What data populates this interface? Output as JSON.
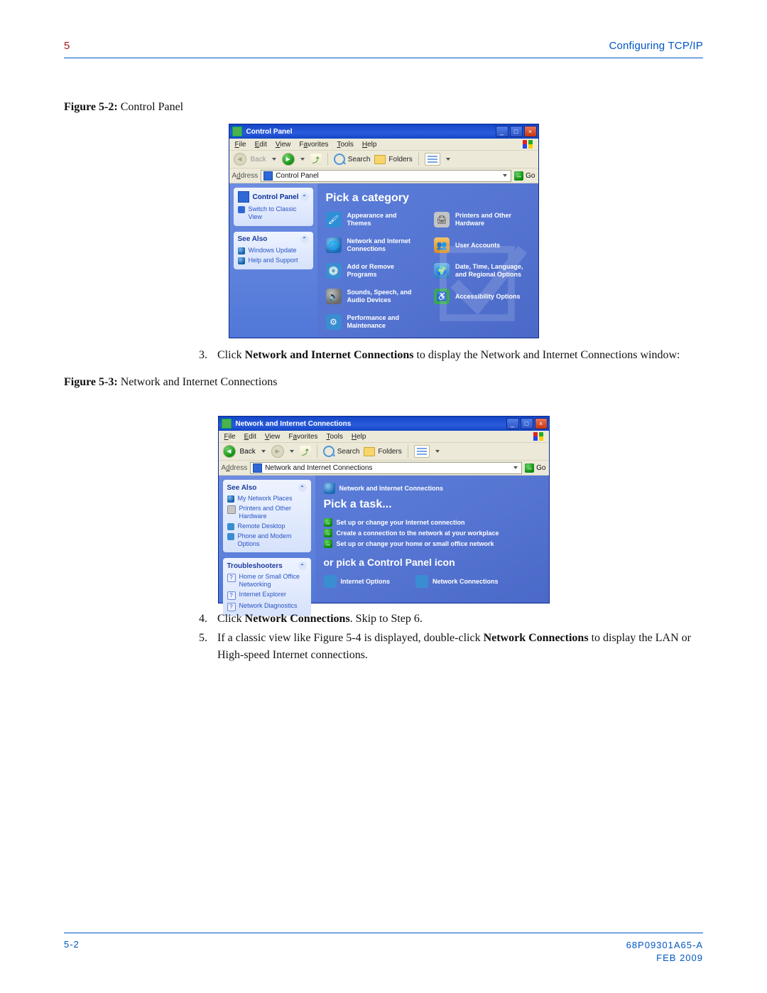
{
  "header": {
    "chapter": "5",
    "title": "Configuring TCP/IP"
  },
  "figure1": {
    "prefix": "Figure 5-2:",
    "caption": "Control Panel"
  },
  "figure2": {
    "prefix": "Figure 5-3:",
    "caption": "Network and Internet Connections"
  },
  "steps": {
    "s3": {
      "num": "3.",
      "pre": "Click ",
      "bold": "Network and Internet Connections",
      "post": " to display the Network and Internet Connections window:"
    },
    "s4": {
      "num": "4.",
      "pre": "Click ",
      "bold": "Network Connections",
      "post": ". Skip to Step 6."
    },
    "s5": {
      "num": "5.",
      "pre": "If a classic view like Figure 5-4 is displayed, double-click ",
      "bold": "Network Connections",
      "post": " to display the LAN or High-speed Internet connections."
    }
  },
  "footer": {
    "left": "5-2",
    "doc": "68P09301A65-A",
    "date": "FEB 2009"
  },
  "win1": {
    "title": "Control Panel",
    "menus": [
      "File",
      "Edit",
      "View",
      "Favorites",
      "Tools",
      "Help"
    ],
    "back": "Back",
    "search": "Search",
    "folders": "Folders",
    "addressLabel": "Address",
    "addressValue": "Control Panel",
    "go": "Go",
    "side": {
      "cp": {
        "title": "Control Panel",
        "switch": "Switch to Classic View"
      },
      "seeAlso": {
        "title": "See Also",
        "items": [
          "Windows Update",
          "Help and Support"
        ]
      }
    },
    "content": {
      "heading": "Pick a category",
      "cats": [
        "Appearance and Themes",
        "Printers and Other Hardware",
        "Network and Internet Connections",
        "User Accounts",
        "Add or Remove Programs",
        "Date, Time, Language, and Regional Options",
        "Sounds, Speech, and Audio Devices",
        "Accessibility Options",
        "Performance and Maintenance"
      ]
    }
  },
  "win2": {
    "title": "Network and Internet Connections",
    "menus": [
      "File",
      "Edit",
      "View",
      "Favorites",
      "Tools",
      "Help"
    ],
    "back": "Back",
    "search": "Search",
    "folders": "Folders",
    "addressLabel": "Address",
    "addressValue": "Network and Internet Connections",
    "go": "Go",
    "side": {
      "seeAlso": {
        "title": "See Also",
        "items": [
          "My Network Places",
          "Printers and Other Hardware",
          "Remote Desktop",
          "Phone and Modem Options"
        ]
      },
      "trouble": {
        "title": "Troubleshooters",
        "items": [
          "Home or Small Office Networking",
          "Internet Explorer",
          "Network Diagnostics"
        ]
      }
    },
    "content": {
      "crumb": "Network and Internet Connections",
      "heading1": "Pick a task...",
      "tasks": [
        "Set up or change your Internet connection",
        "Create a connection to the network at your workplace",
        "Set up or change your home or small office network"
      ],
      "heading2": "or pick a Control Panel icon",
      "icons": [
        "Internet Options",
        "Network Connections"
      ]
    }
  }
}
